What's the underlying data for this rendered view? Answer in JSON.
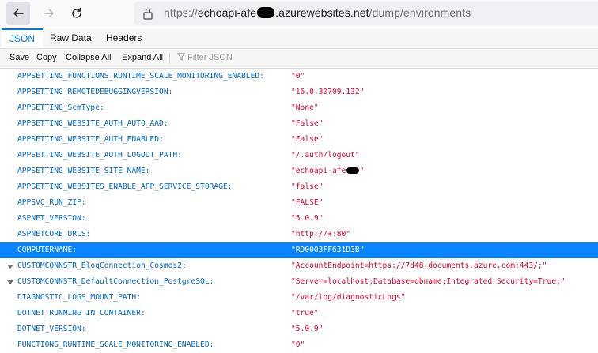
{
  "browser": {
    "url_scheme": "https://",
    "url_host_start": "echoapi-afe",
    "url_host_end": ".azurewebsites.net",
    "url_path": "/dump/environments"
  },
  "tabs": [
    {
      "label": "JSON"
    },
    {
      "label": "Raw Data"
    },
    {
      "label": "Headers"
    }
  ],
  "toolbar": {
    "save": "Save",
    "copy": "Copy",
    "collapse_all": "Collapse All",
    "expand_all": "Expand All",
    "filter_placeholder": "Filter JSON"
  },
  "rows": [
    {
      "key": "APPSETTING_FUNCTIONS_RUNTIME_SCALE_MONITORING_ENABLED:",
      "value": "\"0\""
    },
    {
      "key": "APPSETTING_REMOTEDEBUGGINGVERSION:",
      "value": "\"16.0.30709.132\""
    },
    {
      "key": "APPSETTING_ScmType:",
      "value": "\"None\""
    },
    {
      "key": "APPSETTING_WEBSITE_AUTH_AUTO_AAD:",
      "value": "\"False\""
    },
    {
      "key": "APPSETTING_WEBSITE_AUTH_ENABLED:",
      "value": "\"False\""
    },
    {
      "key": "APPSETTING_WEBSITE_AUTH_LOGOUT_PATH:",
      "value": "\"/.auth/logout\""
    },
    {
      "key": "APPSETTING_WEBSITE_SITE_NAME:",
      "value_start": "\"echoapi-afe",
      "value_end": "\""
    },
    {
      "key": "APPSETTING_WEBSITES_ENABLE_APP_SERVICE_STORAGE:",
      "value": "\"false\""
    },
    {
      "key": "APPSVC_RUN_ZIP:",
      "value": "\"FALSE\""
    },
    {
      "key": "ASPNET_VERSION:",
      "value": "\"5.0.9\""
    },
    {
      "key": "ASPNETCORE_URLS:",
      "value": "\"http://+:80\""
    },
    {
      "key": "COMPUTERNAME:",
      "value": "\"RD0003FF631D3B\""
    },
    {
      "key": "CUSTOMCONNSTR_BlogConnection_Cosmos2:",
      "value": "\"AccountEndpoint=https://7d48.documents.azure.com:443/;\""
    },
    {
      "key": "CUSTOMCONNSTR_DefaultConnection_PostgreSQL:",
      "value": "\"Server=localhost;Database=dbname;Integrated Security=True;\""
    },
    {
      "key": "DIAGNOSTIC_LOGS_MOUNT_PATH:",
      "value": "\"/var/log/diagnosticLogs\""
    },
    {
      "key": "DOTNET_RUNNING_IN_CONTAINER:",
      "value": "\"true\""
    },
    {
      "key": "DOTNET_VERSION:",
      "value": "\"5.0.9\""
    },
    {
      "key": "FUNCTIONS_RUNTIME_SCALE_MONITORING_ENABLED:",
      "value": "\"0\""
    }
  ],
  "colors": {
    "key": "#0064c8",
    "value": "#dd00a9",
    "selection": "#0a84ff",
    "tab_active": "#0074e8"
  }
}
